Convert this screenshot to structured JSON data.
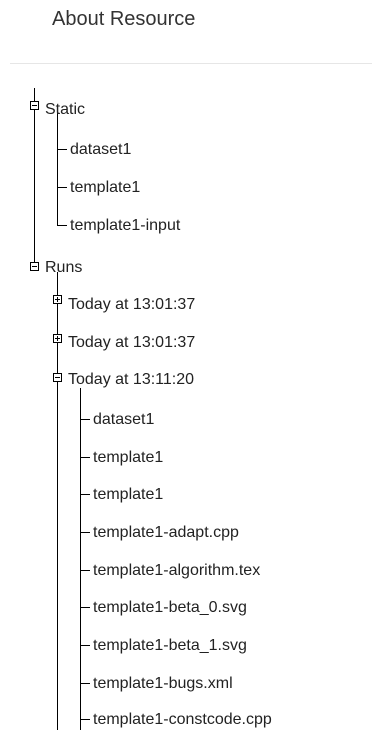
{
  "header": {
    "title": "About Resource"
  },
  "tree": {
    "static": {
      "label": "Static",
      "toggle": "minus",
      "children": [
        "dataset1",
        "template1",
        "template1-input"
      ]
    },
    "runs": {
      "label": "Runs",
      "toggle": "minus",
      "children": [
        {
          "label": "Today at 13:01:37",
          "toggle": "plus"
        },
        {
          "label": "Today at 13:01:37",
          "toggle": "plus"
        },
        {
          "label": "Today at 13:11:20",
          "toggle": "minus",
          "children": [
            "dataset1",
            "template1",
            "template1",
            "template1-adapt.cpp",
            "template1-algorithm.tex",
            "template1-beta_0.svg",
            "template1-beta_1.svg",
            "template1-bugs.xml",
            "template1-constcode.cpp"
          ]
        }
      ]
    }
  },
  "colors": {
    "text": "#222222",
    "divider": "#e6e6e6",
    "tree_line": "#000000"
  }
}
